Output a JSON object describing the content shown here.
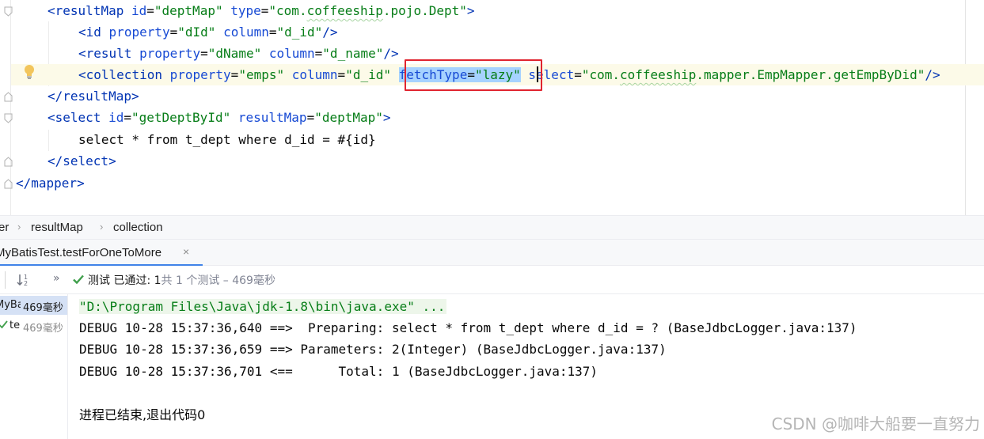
{
  "editor": {
    "lines": [
      [
        {
          "t": "<",
          "c": "tag"
        },
        {
          "t": "resultMap",
          "c": "tag"
        },
        {
          "t": " ",
          "c": "plain"
        },
        {
          "t": "id",
          "c": "attr"
        },
        {
          "t": "=",
          "c": "plain"
        },
        {
          "t": "\"deptMap\"",
          "c": "val"
        },
        {
          "t": " ",
          "c": "plain"
        },
        {
          "t": "type",
          "c": "attr"
        },
        {
          "t": "=",
          "c": "plain"
        },
        {
          "t": "\"com.",
          "c": "val"
        },
        {
          "t": "coffeeship",
          "c": "val squiggle"
        },
        {
          "t": ".pojo.Dept\"",
          "c": "val"
        },
        {
          "t": ">",
          "c": "tag"
        }
      ],
      [
        {
          "t": "<",
          "c": "tag"
        },
        {
          "t": "id",
          "c": "tag"
        },
        {
          "t": " ",
          "c": "plain"
        },
        {
          "t": "property",
          "c": "attr"
        },
        {
          "t": "=",
          "c": "plain"
        },
        {
          "t": "\"dId\"",
          "c": "val"
        },
        {
          "t": " ",
          "c": "plain"
        },
        {
          "t": "column",
          "c": "attr"
        },
        {
          "t": "=",
          "c": "plain"
        },
        {
          "t": "\"d_id\"",
          "c": "val"
        },
        {
          "t": "/>",
          "c": "tag"
        }
      ],
      [
        {
          "t": "<",
          "c": "tag"
        },
        {
          "t": "result",
          "c": "tag"
        },
        {
          "t": " ",
          "c": "plain"
        },
        {
          "t": "property",
          "c": "attr"
        },
        {
          "t": "=",
          "c": "plain"
        },
        {
          "t": "\"dName\"",
          "c": "val"
        },
        {
          "t": " ",
          "c": "plain"
        },
        {
          "t": "column",
          "c": "attr"
        },
        {
          "t": "=",
          "c": "plain"
        },
        {
          "t": "\"d_name\"",
          "c": "val"
        },
        {
          "t": "/>",
          "c": "tag"
        }
      ],
      [
        {
          "t": "<",
          "c": "tag"
        },
        {
          "t": "collection",
          "c": "tag"
        },
        {
          "t": " ",
          "c": "plain"
        },
        {
          "t": "property",
          "c": "attr"
        },
        {
          "t": "=",
          "c": "plain"
        },
        {
          "t": "\"emps\"",
          "c": "val"
        },
        {
          "t": " ",
          "c": "plain"
        },
        {
          "t": "column",
          "c": "attr"
        },
        {
          "t": "=",
          "c": "plain"
        },
        {
          "t": "\"d_id\"",
          "c": "val"
        },
        {
          "t": " ",
          "c": "plain"
        },
        {
          "t": "fetchType",
          "c": "attr sel"
        },
        {
          "t": "=",
          "c": "plain sel"
        },
        {
          "t": "\"lazy\"",
          "c": "val sel"
        },
        {
          "t": " ",
          "c": "plain"
        },
        {
          "t": "select",
          "c": "attr"
        },
        {
          "t": "=",
          "c": "plain"
        },
        {
          "t": "\"com.",
          "c": "val"
        },
        {
          "t": "coffeeship",
          "c": "val squiggle"
        },
        {
          "t": ".mapper.EmpMapper.getEmpByDid\"",
          "c": "val"
        },
        {
          "t": "/>",
          "c": "tag"
        }
      ],
      [
        {
          "t": "</",
          "c": "tag"
        },
        {
          "t": "resultMap",
          "c": "tag"
        },
        {
          "t": ">",
          "c": "tag"
        }
      ],
      [
        {
          "t": "<",
          "c": "tag"
        },
        {
          "t": "select",
          "c": "tag"
        },
        {
          "t": " ",
          "c": "plain"
        },
        {
          "t": "id",
          "c": "attr"
        },
        {
          "t": "=",
          "c": "plain"
        },
        {
          "t": "\"getDeptById\"",
          "c": "val"
        },
        {
          "t": " ",
          "c": "plain"
        },
        {
          "t": "resultMap",
          "c": "attr"
        },
        {
          "t": "=",
          "c": "plain"
        },
        {
          "t": "\"deptMap\"",
          "c": "val"
        },
        {
          "t": ">",
          "c": "tag"
        }
      ],
      [
        {
          "t": "select * from t_dept where d_id = #{id}",
          "c": "plain"
        }
      ],
      [
        {
          "t": "</",
          "c": "tag"
        },
        {
          "t": "select",
          "c": "tag"
        },
        {
          "t": ">",
          "c": "tag"
        }
      ],
      [
        {
          "t": "</",
          "c": "tag"
        },
        {
          "t": "mapper",
          "c": "tag"
        },
        {
          "t": ">",
          "c": "tag"
        }
      ]
    ]
  },
  "breadcrumb": {
    "items": [
      "er",
      "resultMap",
      "collection"
    ]
  },
  "run_tab": {
    "label": "MyBatisTest.testForOneToMore",
    "close": "×"
  },
  "test_toolbar": {
    "more": "»",
    "status": "测试 已通过: 1",
    "detail": "共 1 个测试 – 469毫秒"
  },
  "test_tree": {
    "root_name": "MyBa",
    "root_time": "469毫秒",
    "child_name": "te",
    "child_time": "469毫秒"
  },
  "console": {
    "command": "\"D:\\Program Files\\Java\\jdk-1.8\\bin\\java.exe\" ...",
    "lines": [
      "DEBUG 10-28 15:37:36,640 ==>  Preparing: select * from t_dept where d_id = ? (BaseJdbcLogger.java:137)",
      "DEBUG 10-28 15:37:36,659 ==> Parameters: 2(Integer) (BaseJdbcLogger.java:137)",
      "DEBUG 10-28 15:37:36,701 <==      Total: 1 (BaseJdbcLogger.java:137)"
    ],
    "exit_message": "进程已结束,退出代码0"
  },
  "watermark": "CSDN @咖啡大船要一直努力",
  "colors": {
    "tag": "#0033b3",
    "attribute": "#174ad4",
    "string": "#067d17",
    "selection": "#a6d2ff",
    "highlight_box": "#e0242f",
    "accent": "#4083e8"
  }
}
